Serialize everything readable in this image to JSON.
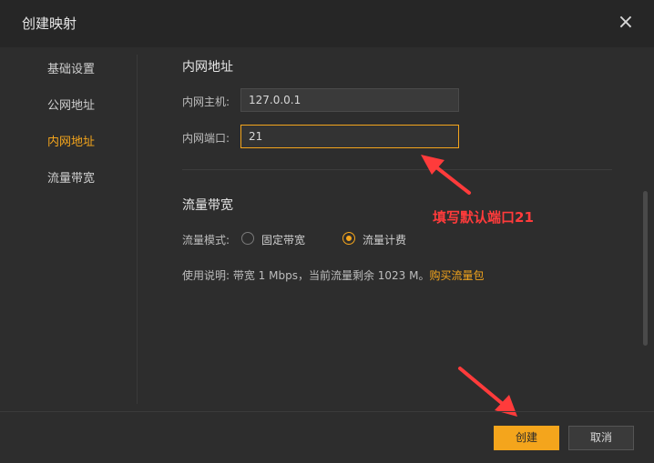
{
  "dialog": {
    "title": "创建映射",
    "close_label": "×"
  },
  "sidebar": {
    "items": [
      {
        "label": "基础设置"
      },
      {
        "label": "公网地址"
      },
      {
        "label": "内网地址"
      },
      {
        "label": "流量带宽"
      }
    ],
    "active_index": 2
  },
  "intranet": {
    "section_title": "内网地址",
    "host_label": "内网主机:",
    "host_value": "127.0.0.1",
    "port_label": "内网端口:",
    "port_value": "21"
  },
  "bandwidth": {
    "section_title": "流量带宽",
    "mode_label": "流量模式:",
    "options": [
      {
        "label": "固定带宽",
        "checked": false
      },
      {
        "label": "流量计费",
        "checked": true
      }
    ],
    "usage_text": "使用说明: 带宽 1 Mbps，当前流量剩余 1023 M。",
    "buy_link": "购买流量包"
  },
  "annotation": {
    "text": "填写默认端口21"
  },
  "footer": {
    "create_label": "创建",
    "cancel_label": "取消"
  },
  "colors": {
    "accent": "#f4a51c",
    "annotation": "#ff3b3b",
    "background": "#2d2d2d"
  }
}
